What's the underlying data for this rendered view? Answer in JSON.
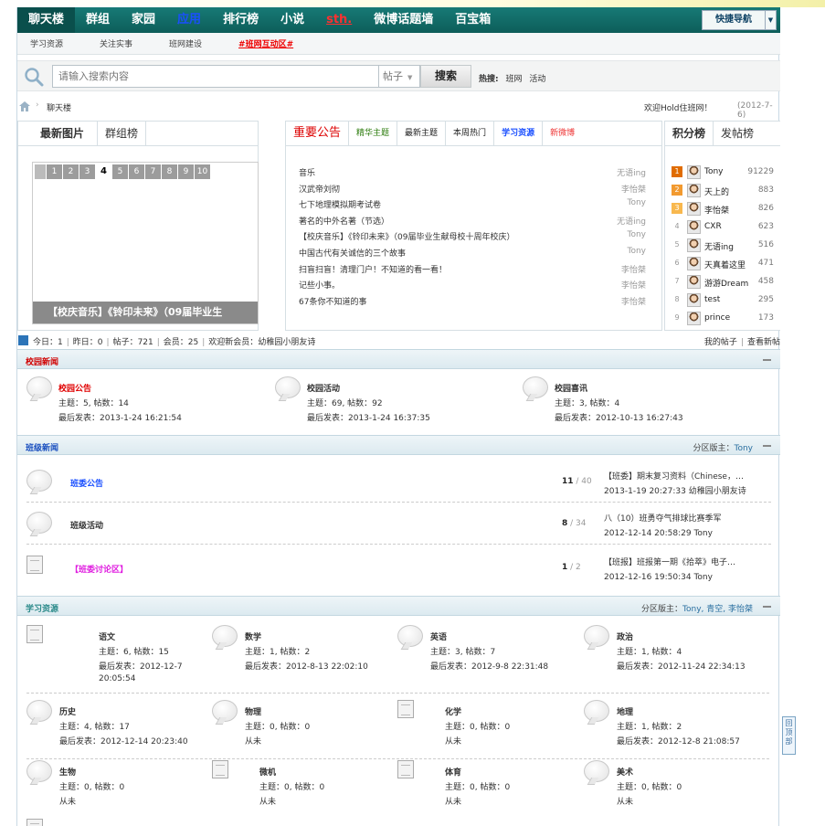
{
  "nav": {
    "items": [
      "聊天楼",
      "群组",
      "家园",
      "应用",
      "排行榜",
      "小说",
      "sth.",
      "微博话题墙",
      "百宝箱"
    ],
    "quick": "快捷导航"
  },
  "subnav": [
    "学习资源",
    "关注实事",
    "班网建设",
    "#班网互动区#"
  ],
  "search": {
    "placeholder": "请输入搜索内容",
    "type": "帖子",
    "button": "搜索",
    "hot_label": "热搜:",
    "hot": [
      "班网",
      "活动"
    ]
  },
  "crumb": {
    "current": "聊天楼",
    "welcome": "欢迎Hold住班网！",
    "date": "(2012-7-6)"
  },
  "left_tabs": [
    "最新图片",
    "群组榜"
  ],
  "slides": {
    "pages": [
      "1",
      "2",
      "3",
      "4",
      "5",
      "6",
      "7",
      "8",
      "9",
      "10"
    ],
    "current_index": 3,
    "caption": "【校庆音乐】《铃印未来》（09届毕业生"
  },
  "mid_tabs": [
    "重要公告",
    "精华主题",
    "最新主题",
    "本周热门",
    "学习资源",
    "新微博"
  ],
  "announcements": [
    {
      "title": "音乐",
      "author": "无语ing"
    },
    {
      "title": "汉武帝刘彻",
      "author": "李怡桀"
    },
    {
      "title": "七下地理模拟期考试卷",
      "author": "Tony"
    },
    {
      "title": "著名的中外名著（节选）",
      "author": "无语ing"
    },
    {
      "title": "【校庆音乐】《铃印未来》（09届毕业生献母校十周年校庆）",
      "author": "Tony"
    },
    {
      "title": "中国古代有关诚信的三个故事",
      "author": "Tony"
    },
    {
      "title": "扫盲扫盲！清理门户！不知道的看一看！",
      "author": "李怡桀"
    },
    {
      "title": "记些小事。",
      "author": "李怡桀"
    },
    {
      "title": "67条你不知道的事",
      "author": "李怡桀"
    }
  ],
  "right_tabs": [
    "积分榜",
    "发帖榜"
  ],
  "ranking": [
    {
      "n": "1",
      "name": "Tony",
      "score": "91229"
    },
    {
      "n": "2",
      "name": "天上的",
      "score": "883"
    },
    {
      "n": "3",
      "name": "李怡桀",
      "score": "826"
    },
    {
      "n": "4",
      "name": "CXR",
      "score": "623"
    },
    {
      "n": "5",
      "name": "无语ing",
      "score": "516"
    },
    {
      "n": "6",
      "name": "天真着这里",
      "score": "471"
    },
    {
      "n": "7",
      "name": "游游Dream",
      "score": "458"
    },
    {
      "n": "8",
      "name": "test",
      "score": "295"
    },
    {
      "n": "9",
      "name": "prince",
      "score": "173"
    }
  ],
  "stats": {
    "today": "今日：1",
    "yesterday": "昨日：0",
    "posts": "帖子：721",
    "members": "会员：25",
    "welcome": "欢迎新会员：",
    "newest": "幼稚园小朋友诗",
    "my_posts": "我的帖子",
    "view_new": "查看新帖"
  },
  "categories": {
    "campus": {
      "name": "校园新闻"
    },
    "class": {
      "name": "班级新闻",
      "mod_label": "分区版主：",
      "mod": "Tony"
    },
    "study": {
      "name": "学习资源",
      "mod_label": "分区版主：",
      "mod": "Tony, 青空, 李怡桀"
    }
  },
  "campus_forums": [
    {
      "name": "校园公告",
      "stat": "主题：5, 帖数：14",
      "last": "最后发表：2013-1-24 16:21:54",
      "color": "#e00000"
    },
    {
      "name": "校园活动",
      "stat": "主题：69, 帖数：92",
      "last": "最后发表：2013-1-24 16:37:35",
      "color": "#333333"
    },
    {
      "name": "校园喜讯",
      "stat": "主题：3, 帖数：4",
      "last": "最后发表：2012-10-13 16:27:43",
      "color": "#333333"
    }
  ],
  "class_forums": [
    {
      "name": "班委公告",
      "color": "#1a4fff",
      "count_main": "11",
      "count_sub": "40",
      "last_title": "【班委】期末复习资料（Chinese，…",
      "last_meta": "2013-1-19 20:27:33 幼稚园小朋友诗"
    },
    {
      "name": "班级活动",
      "color": "#333333",
      "count_main": "8",
      "count_sub": "34",
      "last_title": "八（10）班勇夺气排球比赛季军",
      "last_meta": "2012-12-14 20:58:29 Tony"
    },
    {
      "name": "【班委讨论区】",
      "color": "#e020e0",
      "count_main": "1",
      "count_sub": "2",
      "last_title": "【班报】班报第一期《拾萃》电子…",
      "last_meta": "2012-12-16 19:50:34 Tony"
    }
  ],
  "study_forums": [
    {
      "name": "语文",
      "l1": "主题：6, 帖数：15",
      "l2": "最后发表：2012-12-7",
      "l3": "20:05:54"
    },
    {
      "name": "数学",
      "l1": "主题：1, 帖数：2",
      "l2": "最后发表：2012-8-13 22:02:10",
      "l3": ""
    },
    {
      "name": "英语",
      "l1": "主题：3, 帖数：7",
      "l2": "最后发表：2012-9-8 22:31:48",
      "l3": ""
    },
    {
      "name": "政治",
      "l1": "主题：1, 帖数：4",
      "l2": "最后发表：2012-11-24 22:34:13",
      "l3": ""
    },
    {
      "name": "历史",
      "l1": "主题：4, 帖数：17",
      "l2": "最后发表：2012-12-14 20:23:40",
      "l3": ""
    },
    {
      "name": "物理",
      "l1": "主题：0, 帖数：0",
      "l2": "从未",
      "l3": ""
    },
    {
      "name": "化学",
      "l1": "主题：0, 帖数：0",
      "l2": "从未",
      "l3": ""
    },
    {
      "name": "地理",
      "l1": "主题：1, 帖数：2",
      "l2": "最后发表：2012-12-8 21:08:57",
      "l3": ""
    },
    {
      "name": "生物",
      "l1": "主题：0, 帖数：0",
      "l2": "从未",
      "l3": ""
    },
    {
      "name": "微机",
      "l1": "主题：0, 帖数：0",
      "l2": "从未",
      "l3": ""
    },
    {
      "name": "体育",
      "l1": "主题：0, 帖数：0",
      "l2": "从未",
      "l3": ""
    },
    {
      "name": "美术",
      "l1": "主题：0, 帖数：0",
      "l2": "从未",
      "l3": ""
    }
  ],
  "gotop": "回顶部",
  "colors": {
    "nav": "#0d5d5a",
    "campus_title": "#d00000",
    "class_title": "#1a4fbf",
    "study_title": "#2b8a8a"
  }
}
